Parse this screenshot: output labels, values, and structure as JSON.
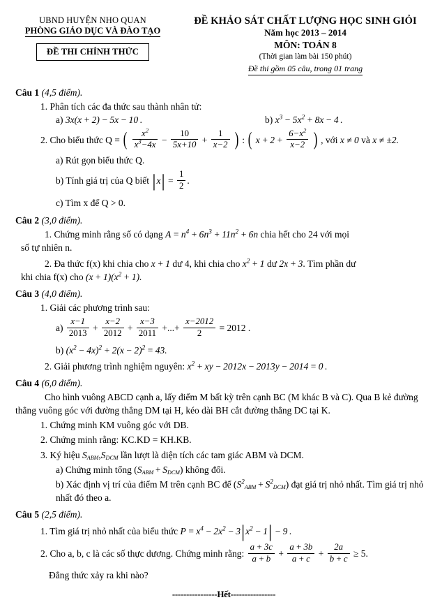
{
  "header": {
    "org_line1": "UBND HUYỆN NHO QUAN",
    "org_line2": "PHÒNG GIÁO DỤC VÀ ĐÀO TẠO",
    "exam_box_label": "ĐỀ THI CHÍNH  THỨC",
    "title_main": "ĐỀ KHẢO SÁT CHẤT LƯỢNG HỌC SINH GIỎI",
    "title_year": "Năm học 2013 – 2014",
    "title_subject": "MÔN: TOÁN 8",
    "title_time": "(Thời gian làm bài 150 phút)",
    "title_note": "Đề thi gồm 05 câu, trong 01 trang"
  },
  "questions": [
    {
      "label": "Câu 1",
      "points": "(4,5 điểm).",
      "items": {
        "q1_1": "1. Phân tích các đa thức sau thành nhân tử:",
        "q1_1a_label": "a)",
        "q1_1b_label": "b)",
        "q1_2_lead": "2. Cho biểu thức Q =",
        "q1_2_tail_voi": ", với",
        "q1_2_tail_va": "và",
        "q1_2a": "a) Rút gọn biểu thức Q.",
        "q1_2b_pre": "b) Tính giá trị của Q biết",
        "q1_2c": "c) Tìm x để Q > 0."
      }
    },
    {
      "label": "Câu 2",
      "points": "(3,0 điểm).",
      "items": {
        "q2_1_pre": "1. Chứng minh rằng số có dạng",
        "q2_1_post": "chia hết cho 24 với mọi",
        "q2_1_cont": "số tự nhiên n.",
        "q2_2_pre": "2. Đa thức f(x) khi chia cho",
        "q2_2_mid": "dư 4, khi chia cho",
        "q2_2_mid2": "dư",
        "q2_2_post": ". Tìm phần dư",
        "q2_2_cont": "khi chia f(x) cho"
      }
    },
    {
      "label": "Câu 3",
      "points": "(4,0 điểm).",
      "items": {
        "q3_1": "1. Giải các phương trình sau:",
        "q3_1a_label": "a)",
        "q3_1b_label": "b)",
        "q3_2_pre": "2. Giải phương trình nghiệm nguyên:"
      }
    },
    {
      "label": "Câu 4",
      "points": "(6,0 điểm).",
      "items": {
        "q4_intro": "Cho hình vuông ABCD cạnh a, lấy điểm M bất kỳ trên cạnh BC (M khác B và C). Qua B kẻ đường thẳng vuông góc với đường thẳng DM tại H, kéo dài BH cắt đường thẳng DC tại K.",
        "q4_1": "1. Chứng minh KM vuông góc với DB.",
        "q4_2": "2. Chứng minh rằng:  KC.KD = KH.KB.",
        "q4_3_pre": "3. Ký hiệu",
        "q4_3_post": "lần lượt là diện tích các tam giác ABM và DCM.",
        "q4_3a_pre": "a) Chứng minh tổng (",
        "q4_3a_post": ") không đổi.",
        "q4_3b_pre": "b) Xác định vị trí của điểm M trên cạnh BC để (",
        "q4_3b_post": ") đạt giá trị nhỏ nhất. Tìm giá trị nhỏ nhất đó theo a."
      }
    },
    {
      "label": "Câu 5",
      "points": "(2,5 điểm).",
      "items": {
        "q5_1_pre": "1. Tìm giá trị nhỏ nhất của biểu thức",
        "q5_2_pre": "2. Cho a, b, c là các số thực dương. Chứng minh rằng:",
        "q5_3": "Đẳng thức xảy ra khi nào?"
      }
    }
  ],
  "math": {
    "q1_1a": "3x(x + 2) − 5x − 10 .",
    "q1_1b": "x³ − 5x² + 8x − 4 .",
    "q1_2_condition_x0": "x ≠ 0",
    "q1_2_condition_x2": "x ≠ ±2.",
    "q1_frac1_num": "x",
    "q1_frac1_den": "x³ − 4x",
    "q1_frac2_num": "10",
    "q1_frac2_den": "5x + 10",
    "q1_frac3_num": "1",
    "q1_frac3_den": "x − 2",
    "q1_frac4_num": "6 − x",
    "q1_frac4_den": "x − 2",
    "q1_2b_abs_num": "1",
    "q1_2b_abs_den": "2",
    "q2_A": "A = n⁴ + 6n³ + 11n² + 6n",
    "q2_xp1": "x + 1",
    "q2_x2p1": "x² + 1",
    "q2_rem": "2x + 3",
    "q2_prod": "(x + 1)(x² + 1).",
    "q3_f1_num": "x − 1",
    "q3_f1_den": "2013",
    "q3_f2_num": "x − 2",
    "q3_f2_den": "2012",
    "q3_f3_num": "x − 3",
    "q3_f3_den": "2011",
    "q3_f4_num": "x − 2012",
    "q3_f4_den": "2",
    "q3_rhs": "= 2012 .",
    "q3_1b": "(x² − 4x)² + 2(x − 2)² = 43.",
    "q3_2eq": "x² + xy − 2012x − 2013y − 2014 = 0 .",
    "q4_S_ABM": "S",
    "q4_sub_ABM": "ABM",
    "q4_S_DCM": "S",
    "q4_sub_DCM": "DCM",
    "q5_P": "P = x⁴ − 2x² − 3",
    "q5_abs_inner": "x² − 1",
    "q5_P_tail": "− 9 .",
    "q5_f1_num": "a + 3c",
    "q5_f1_den": "a + b",
    "q5_f2_num": "a + 3b",
    "q5_f2_den": "a + c",
    "q5_f3_num": "2a",
    "q5_f3_den": "b + c",
    "q5_ineq_rhs": "≥ 5."
  },
  "footer": {
    "end_marker": "----------------Hết----------------"
  }
}
